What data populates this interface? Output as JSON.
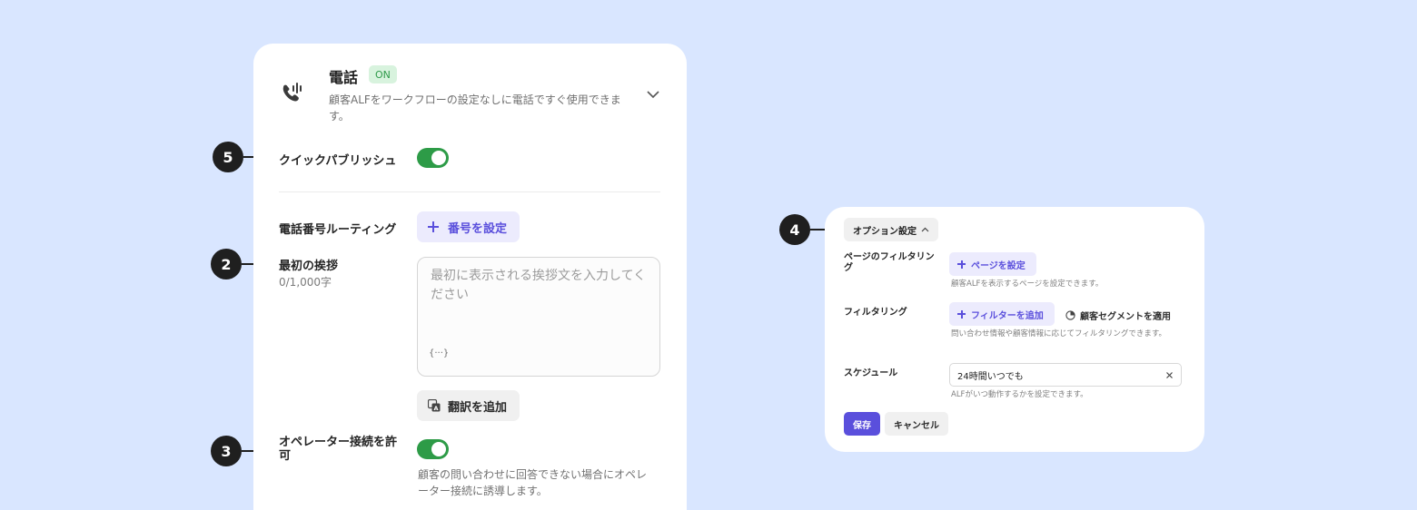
{
  "markers": {
    "m5": "5",
    "m2": "2",
    "m3": "3",
    "m4": "4"
  },
  "phone_card": {
    "icon": "phone-call-icon",
    "title": "電話",
    "badge": "ON",
    "description": "顧客ALFをワークフローの設定なしに電話ですぐ使用できます。",
    "quick_publish": {
      "label": "クイックパブリッシュ",
      "enabled": true
    },
    "routing": {
      "label": "電話番号ルーティング",
      "button": "番号を設定"
    },
    "greeting": {
      "label": "最初の挨拶",
      "count": "0/1,000字",
      "placeholder": "最初に表示される挨拶文を入力してください",
      "variable": "{···}",
      "translate_button": "翻訳を追加"
    },
    "operator": {
      "label": "オペレーター接続を許可",
      "enabled": true,
      "help": "顧客の問い合わせに回答できない場合にオペレーター接続に誘導します。"
    }
  },
  "options_card": {
    "options_button": "オプション設定",
    "page_filter": {
      "label": "ページのフィルタリング",
      "button": "ページを設定",
      "help": "顧客ALFを表示するページを設定できます。"
    },
    "filtering": {
      "label": "フィルタリング",
      "button": "フィルターを追加",
      "segment_button": "顧客セグメントを適用",
      "help": "問い合わせ情報や顧客情報に応じてフィルタリングできます。"
    },
    "schedule": {
      "label": "スケジュール",
      "value": "24時間いつでも",
      "help": "ALFがいつ動作するかを設定できます。"
    },
    "save": "保存",
    "cancel": "キャンセル"
  },
  "colors": {
    "background": "#d9e6ff",
    "accent": "#5a4fdc",
    "toggle_on": "#2d9b47",
    "badge_bg": "#d8f3de"
  }
}
